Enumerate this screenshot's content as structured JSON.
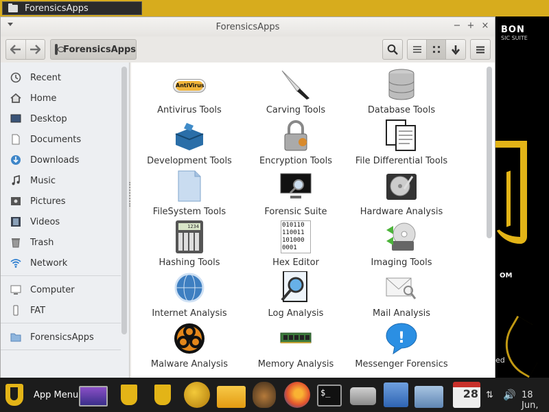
{
  "top_panel": {
    "task_title": "ForensicsApps",
    "task_icon": "folder-icon",
    "color": "#d7ac1d"
  },
  "desktop": {
    "logo_text": "BON",
    "logo_sub": "SIC SUITE",
    "brand_bottom": "OM",
    "brand_partial": "ed"
  },
  "window": {
    "title": "ForensicsApps",
    "controls": {
      "menu": "▾",
      "minimize": "−",
      "maximize": "+",
      "close": "×"
    },
    "path": {
      "label": "ForensicsApps",
      "icon": "drive-icon"
    },
    "sidebar": {
      "places": [
        {
          "label": "Recent",
          "icon": "clock-icon"
        },
        {
          "label": "Home",
          "icon": "home-icon"
        },
        {
          "label": "Desktop",
          "icon": "desktop-icon"
        },
        {
          "label": "Documents",
          "icon": "document-icon"
        },
        {
          "label": "Downloads",
          "icon": "download-icon"
        },
        {
          "label": "Music",
          "icon": "music-icon"
        },
        {
          "label": "Pictures",
          "icon": "pictures-icon"
        },
        {
          "label": "Videos",
          "icon": "video-icon"
        },
        {
          "label": "Trash",
          "icon": "trash-icon"
        },
        {
          "label": "Network",
          "icon": "wifi-icon"
        }
      ],
      "devices": [
        {
          "label": "Computer",
          "icon": "computer-icon"
        },
        {
          "label": "FAT",
          "icon": "usb-drive-icon"
        }
      ],
      "bookmarks": [
        {
          "label": "ForensicsApps",
          "icon": "folder-icon"
        }
      ]
    },
    "files": [
      {
        "label": "Antivirus Tools",
        "icon": "antivirus-icon",
        "badge": "AntiVirus"
      },
      {
        "label": "Carving Tools",
        "icon": "knife-icon"
      },
      {
        "label": "Database Tools",
        "icon": "database-icon"
      },
      {
        "label": "Development Tools",
        "icon": "toolbox-icon"
      },
      {
        "label": "Encryption Tools",
        "icon": "padlock-icon"
      },
      {
        "label": "File Differential Tools",
        "icon": "documents-icon"
      },
      {
        "label": "FileSystem Tools",
        "icon": "file-icon"
      },
      {
        "label": "Forensic Suite",
        "icon": "monitor-magnifier-icon"
      },
      {
        "label": "Hardware Analysis",
        "icon": "hard-drive-icon"
      },
      {
        "label": "Hashing Tools",
        "icon": "calculator-icon",
        "display": "1234"
      },
      {
        "label": "Hex Editor",
        "icon": "hex-icon",
        "hex_lines": [
          "010110",
          "110011",
          "101000",
          "0001"
        ]
      },
      {
        "label": "Imaging Tools",
        "icon": "disc-imaging-icon"
      },
      {
        "label": "Internet Analysis",
        "icon": "globe-icon"
      },
      {
        "label": "Log Analysis",
        "icon": "log-magnifier-icon"
      },
      {
        "label": "Mail Analysis",
        "icon": "mail-icon"
      },
      {
        "label": "Malware Analysis",
        "icon": "biohazard-icon"
      },
      {
        "label": "Memory Analysis",
        "icon": "ram-icon"
      },
      {
        "label": "Messenger Forensics",
        "icon": "chat-bubble-icon"
      }
    ]
  },
  "taskbar": {
    "app_menu_label": "App Menu",
    "clock": "18 Jun,",
    "calendar_day": "28",
    "launchers": [
      "monitor-icon",
      "shield-icon",
      "shield-icon",
      "shield-globe-icon",
      "folder-icon",
      "dog-icon",
      "firefox-icon",
      "terminal-icon",
      "camera-icon",
      "text-editor-icon",
      "home-folder-icon",
      "calendar-clock-icon"
    ],
    "terminal_label": "$_"
  },
  "colors": {
    "accent": "#e3b417",
    "sidebar_bg": "#edeff2",
    "window_bg": "#eae8e5"
  }
}
